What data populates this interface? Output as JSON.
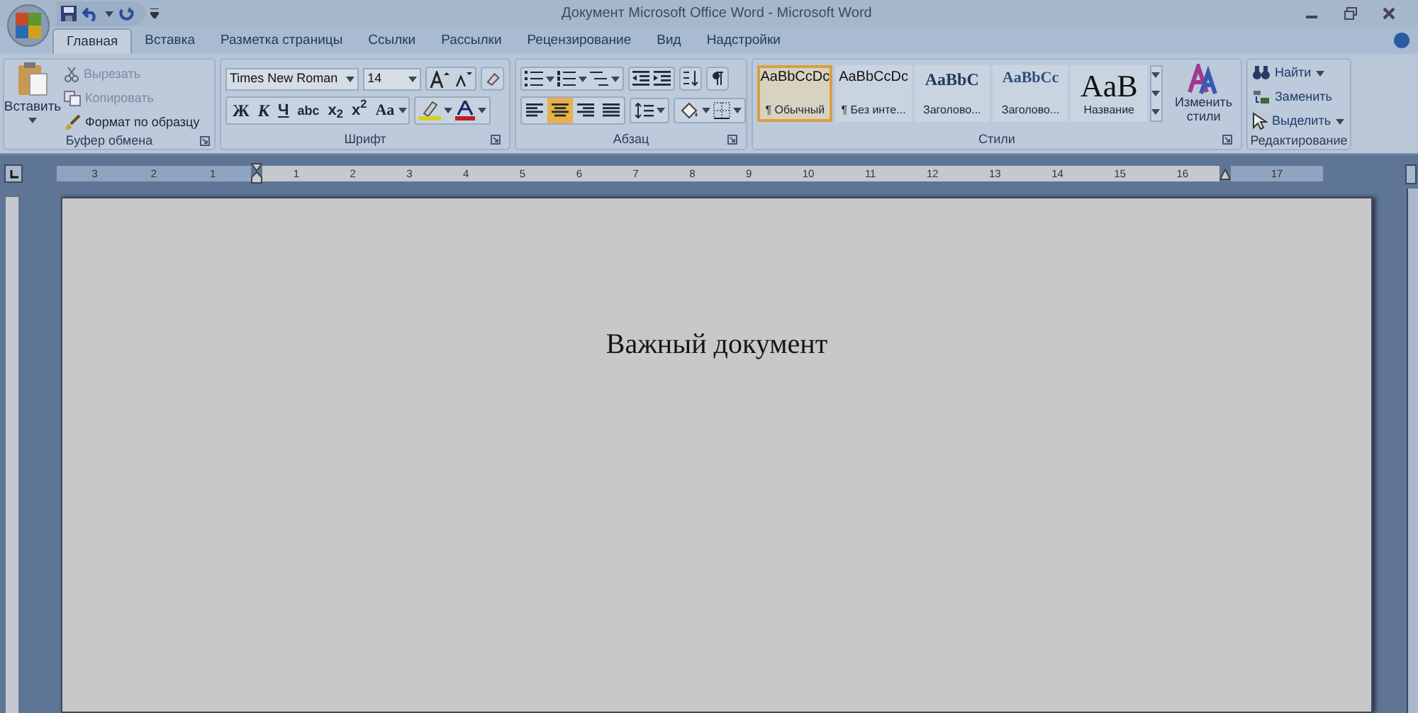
{
  "window": {
    "title": "Документ Microsoft Office Word - Microsoft Word"
  },
  "tabs": [
    {
      "label": "Главная",
      "selected": true
    },
    {
      "label": "Вставка",
      "selected": false
    },
    {
      "label": "Разметка страницы",
      "selected": false
    },
    {
      "label": "Ссылки",
      "selected": false
    },
    {
      "label": "Рассылки",
      "selected": false
    },
    {
      "label": "Рецензирование",
      "selected": false
    },
    {
      "label": "Вид",
      "selected": false
    },
    {
      "label": "Надстройки",
      "selected": false
    }
  ],
  "clipboard": {
    "label": "Буфер обмена",
    "paste_label": "Вставить",
    "items": [
      {
        "kind": "cut",
        "label": "Вырезать",
        "disabled": true
      },
      {
        "kind": "copy",
        "label": "Копировать",
        "disabled": true
      },
      {
        "kind": "format",
        "label": "Формат по образцу",
        "disabled": false
      }
    ]
  },
  "font": {
    "label": "Шрифт",
    "font_name": "Times New Roman",
    "font_size": "14",
    "format_buttons": [
      {
        "kind": "bold",
        "text": "Ж"
      },
      {
        "kind": "italic",
        "text": "К"
      },
      {
        "kind": "underline",
        "text": "Ч"
      },
      {
        "kind": "strike",
        "text": "abc"
      },
      {
        "kind": "sub",
        "text": "x$_{2}$"
      },
      {
        "kind": "sup",
        "text": "x$^{2}$"
      },
      {
        "kind": "case",
        "text": "Aa"
      }
    ]
  },
  "paragraph": {
    "label": "Абзац",
    "alignments": [
      {
        "kind": "left",
        "selected": false
      },
      {
        "kind": "center",
        "selected": true
      },
      {
        "kind": "right",
        "selected": false
      },
      {
        "kind": "justify",
        "selected": false
      }
    ]
  },
  "styles": {
    "label": "Стили",
    "change_label": "Изменить стили",
    "items": [
      {
        "kind": "body",
        "preview": "AaBbCcDc",
        "name": "¶ Обычный",
        "selected": true
      },
      {
        "kind": "body",
        "preview": "AaBbCcDc",
        "name": "¶ Без инте...",
        "selected": false
      },
      {
        "kind": "heading1",
        "preview": "AaBbC",
        "name": "Заголово...",
        "selected": false
      },
      {
        "kind": "heading2",
        "preview": "AaBbCc",
        "name": "Заголово...",
        "selected": false
      },
      {
        "kind": "title",
        "preview": "AaB",
        "name": "Название",
        "selected": false
      }
    ]
  },
  "editing": {
    "label": "Редактирование",
    "items": [
      {
        "kind": "find",
        "label": "Найти",
        "dropdown": true
      },
      {
        "kind": "replace",
        "label": "Заменить",
        "dropdown": false
      },
      {
        "kind": "select",
        "label": "Выделить",
        "dropdown": true
      }
    ]
  },
  "ruler": {
    "left_numbers": [
      "3",
      "2",
      "1"
    ],
    "numbers": [
      "1",
      "2",
      "3",
      "4",
      "5",
      "6",
      "7",
      "8",
      "9",
      "10",
      "11",
      "12",
      "13",
      "14",
      "15",
      "16",
      "17"
    ]
  },
  "document": {
    "heading": "Важный документ"
  }
}
